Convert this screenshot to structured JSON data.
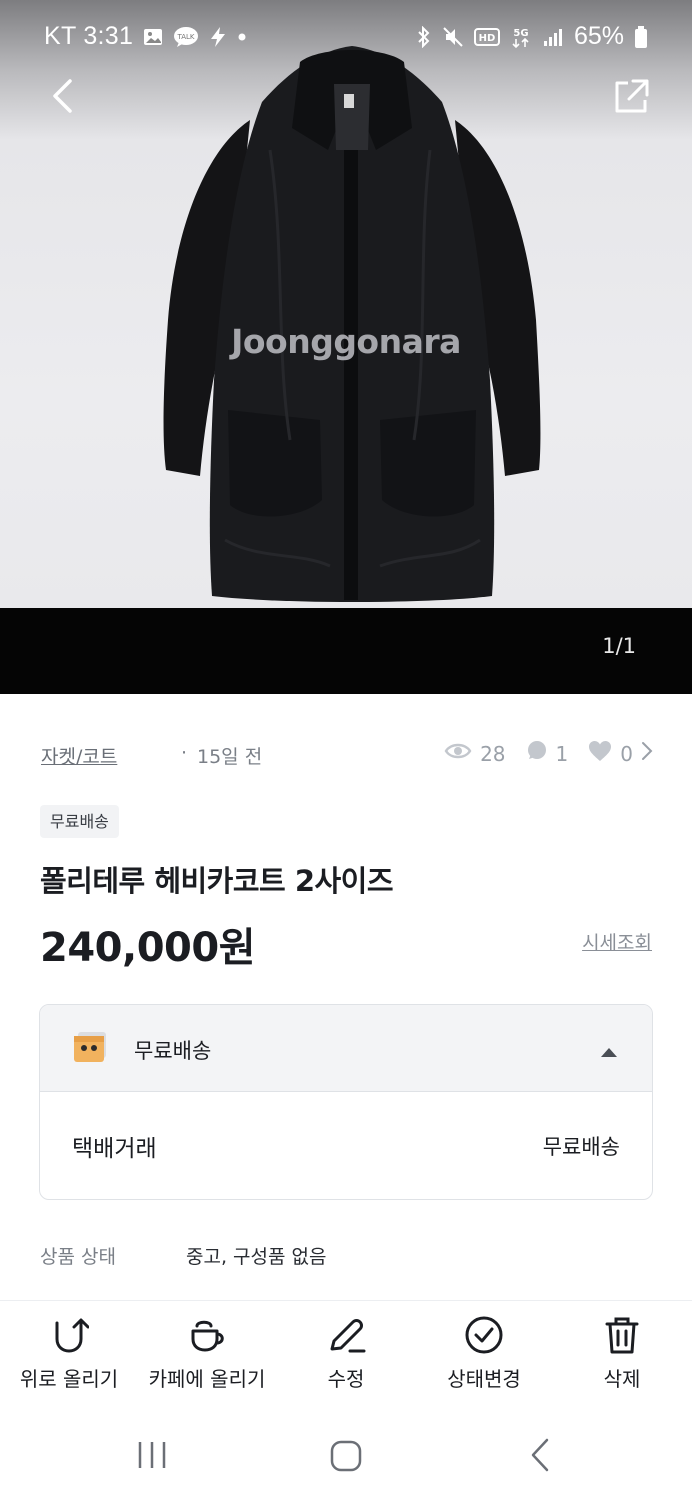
{
  "status_bar": {
    "carrier_time": "KT 3:31",
    "battery": "65%",
    "icons": [
      "gallery-icon",
      "talk-icon",
      "bolt-icon",
      "dot-icon",
      "bluetooth-icon",
      "mute-icon",
      "hd-icon",
      "5g-icon",
      "signal-icon",
      "battery-icon"
    ],
    "talk_text": "TALK",
    "hd_text": "HD",
    "fiveg_text": "5G"
  },
  "header": {
    "back_icon": "chevron-left-icon",
    "share_icon": "share-external-icon"
  },
  "photo": {
    "watermark": "Joonggonara",
    "counter": "1/1"
  },
  "product": {
    "category": "자켓/코트",
    "separator": "·",
    "posted": "15일 전",
    "views": "28",
    "chats": "1",
    "likes": "0",
    "badge": "무료배송",
    "title": "폴리테루 헤비카코트 2사이즈",
    "price": "240,000원",
    "price_check_link": "시세조회"
  },
  "shipping": {
    "header_label": "무료배송",
    "method_label": "택배거래",
    "method_value": "무료배송"
  },
  "condition": {
    "label": "상품 상태",
    "value": "중고, 구성품 없음"
  },
  "actions": [
    {
      "label": "위로 올리기",
      "icon": "bump-up-icon"
    },
    {
      "label": "카페에 올리기",
      "icon": "cafe-cup-icon"
    },
    {
      "label": "수정",
      "icon": "pencil-icon"
    },
    {
      "label": "상태변경",
      "icon": "check-circle-icon"
    },
    {
      "label": "삭제",
      "icon": "trash-icon"
    }
  ],
  "colors": {
    "text_primary": "#1b1d22",
    "text_muted": "#7a7f87",
    "border": "#dfe2e6",
    "panel_bg": "#f3f4f6"
  }
}
